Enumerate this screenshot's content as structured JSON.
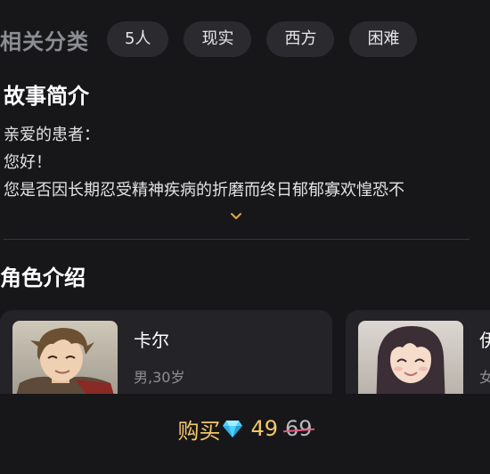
{
  "categories": {
    "title": "相关分类",
    "tags": [
      "5人",
      "现实",
      "西方",
      "困难"
    ]
  },
  "story": {
    "title": "故事简介",
    "lines": [
      "亲爱的患者：",
      "您好！",
      "您是否因长期忍受精神疾病的折磨而终日郁郁寡欢惶恐不"
    ],
    "expand_icon": "chevron-down-icon"
  },
  "characters": {
    "title": "角色介绍",
    "items": [
      {
        "name": "卡尔",
        "meta": "男,30岁"
      },
      {
        "name": "伊",
        "meta": "女"
      }
    ]
  },
  "purchase": {
    "label": "购买",
    "currency_icon": "diamond-icon",
    "price": "49",
    "original_price": "69"
  },
  "colors": {
    "background": "#17171a",
    "tag_bg": "#2b2b2f",
    "accent_gold": "#f2c66a",
    "strike_pink": "#e05a7a",
    "gem_blue": "#4fd2ff"
  }
}
